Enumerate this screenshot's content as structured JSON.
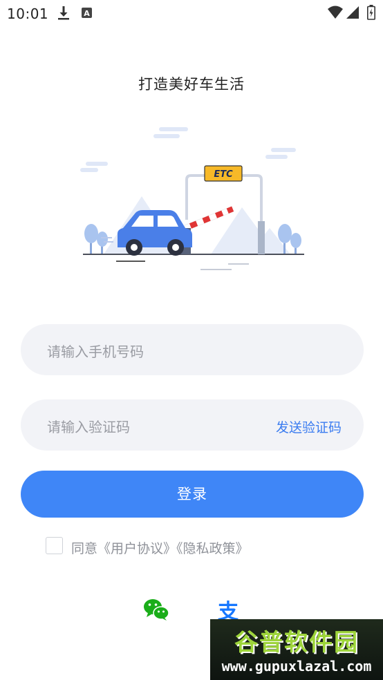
{
  "status_bar": {
    "time": "10:01",
    "icons": [
      "download-icon",
      "a-notification-icon",
      "wifi-icon",
      "signal-icon",
      "battery-icon"
    ]
  },
  "slogan": "打造美好车生活",
  "illustration": {
    "sign_text": "ETC"
  },
  "form": {
    "phone_placeholder": "请输入手机号码",
    "code_placeholder": "请输入验证码",
    "send_code_label": "发送验证码",
    "login_label": "登录"
  },
  "agreement": {
    "prefix": "同意",
    "user_agreement": "《用户协议》",
    "privacy_policy": "《隐私政策》",
    "checked": false
  },
  "social_login": [
    "wechat-icon",
    "alipay-icon"
  ],
  "watermark": {
    "logo_text": "谷普软件园",
    "url_text": "www.gupuxlazal.com"
  },
  "colors": {
    "accent": "#3f86f7",
    "link": "#3b7cf0",
    "field_bg": "#f2f3f7",
    "wechat_green": "#1aad19",
    "alipay_blue": "#1677ff",
    "car_blue": "#4a7fe8"
  }
}
